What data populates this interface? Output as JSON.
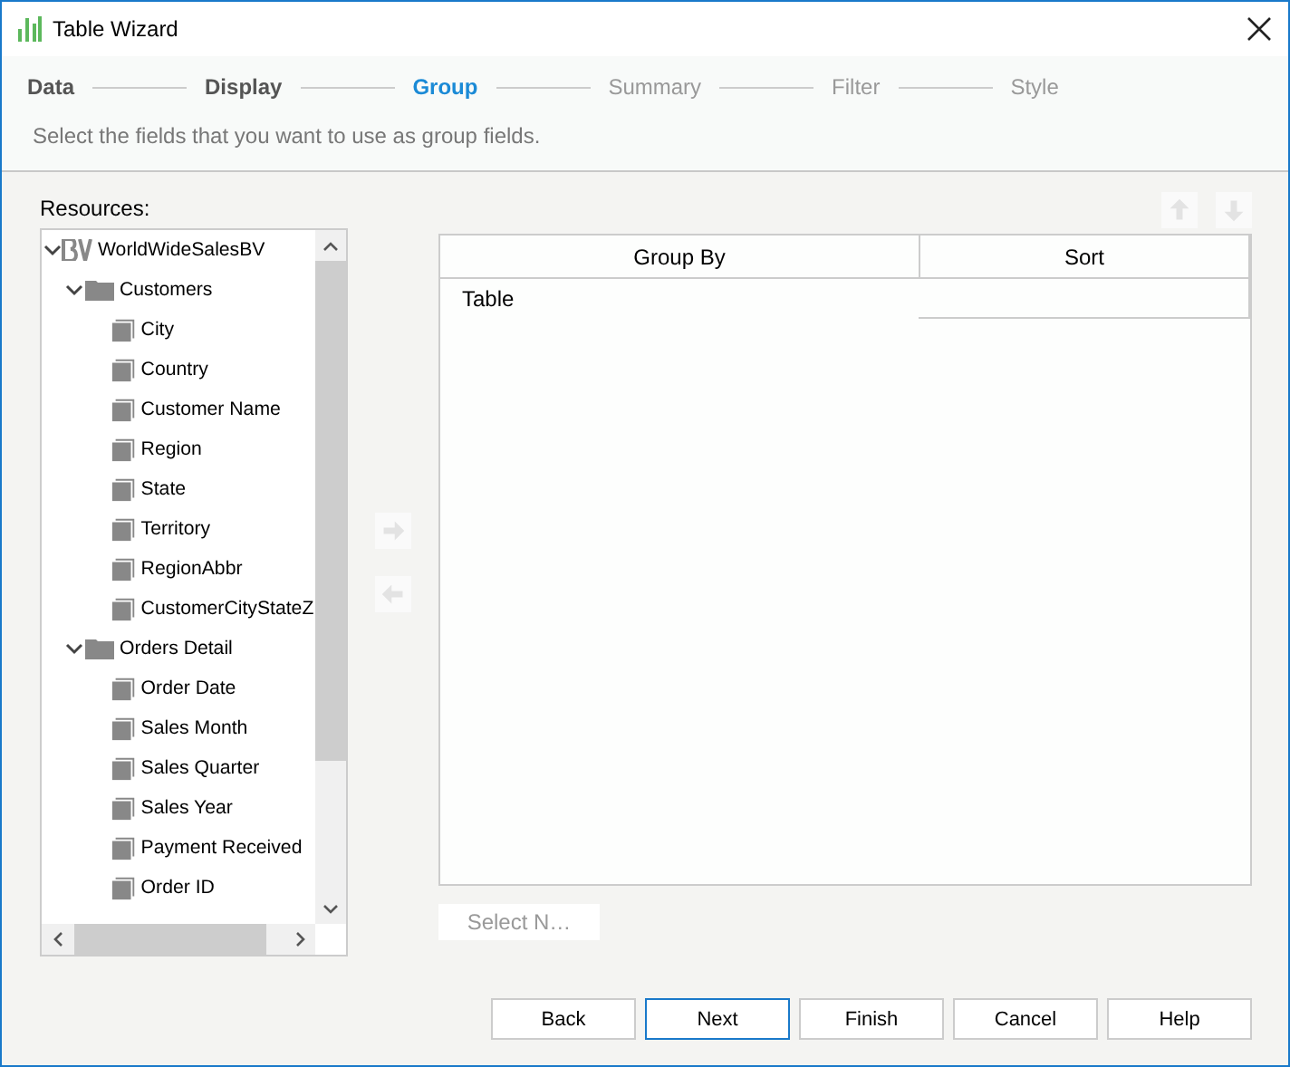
{
  "window": {
    "title": "Table Wizard"
  },
  "steps": [
    {
      "label": "Data",
      "selected": false,
      "done": true
    },
    {
      "label": "Display",
      "selected": false,
      "done": true
    },
    {
      "label": "Group",
      "selected": true,
      "done": false
    },
    {
      "label": "Summary",
      "selected": false,
      "done": false
    },
    {
      "label": "Filter",
      "selected": false,
      "done": false
    },
    {
      "label": "Style",
      "selected": false,
      "done": false
    }
  ],
  "description": "Select the fields that you want to use as group fields.",
  "resources": {
    "label": "Resources:",
    "tree": [
      {
        "label": "WorldWideSalesBV",
        "kind": "catalog",
        "expanded": true,
        "children": [
          {
            "label": "Customers",
            "kind": "folder",
            "expanded": true,
            "children": [
              {
                "label": "City",
                "kind": "field"
              },
              {
                "label": "Country",
                "kind": "field"
              },
              {
                "label": "Customer Name",
                "kind": "field"
              },
              {
                "label": "Region",
                "kind": "field"
              },
              {
                "label": "State",
                "kind": "field"
              },
              {
                "label": "Territory",
                "kind": "field"
              },
              {
                "label": "RegionAbbr",
                "kind": "field"
              },
              {
                "label": "CustomerCityStateZ",
                "kind": "field"
              }
            ]
          },
          {
            "label": "Orders Detail",
            "kind": "folder",
            "expanded": true,
            "children": [
              {
                "label": "Order Date",
                "kind": "field"
              },
              {
                "label": "Sales Month",
                "kind": "field"
              },
              {
                "label": "Sales Quarter",
                "kind": "field"
              },
              {
                "label": "Sales Year",
                "kind": "field"
              },
              {
                "label": "Payment Received",
                "kind": "field"
              },
              {
                "label": "Order ID",
                "kind": "field"
              }
            ]
          }
        ]
      }
    ]
  },
  "transfer": {
    "add_disabled": true,
    "remove_disabled": true,
    "up_disabled": true,
    "down_disabled": true
  },
  "table": {
    "columns": [
      "Group By",
      "Sort"
    ],
    "rows": [
      [
        "Table",
        ""
      ]
    ]
  },
  "select_button": {
    "label": "Select N…",
    "disabled": true
  },
  "buttons": [
    {
      "label": "Back",
      "default": false
    },
    {
      "label": "Next",
      "default": true
    },
    {
      "label": "Finish",
      "default": false
    },
    {
      "label": "Cancel",
      "default": false
    },
    {
      "label": "Help",
      "default": false
    }
  ]
}
